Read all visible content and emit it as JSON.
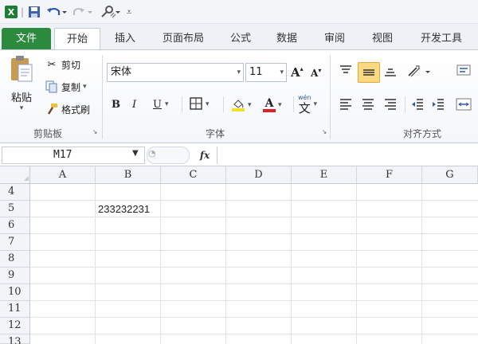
{
  "qat": {
    "excel_icon": "excel-logo-icon",
    "save_icon": "save-icon",
    "undo_icon": "undo-icon",
    "redo_icon": "redo-icon",
    "customize_icon": "customize-icon",
    "separator": "|"
  },
  "tabs": [
    "文件",
    "开始",
    "插入",
    "页面布局",
    "公式",
    "数据",
    "审阅",
    "视图",
    "开发工具"
  ],
  "clipboard": {
    "paste_label": "粘贴",
    "cut_label": "剪切",
    "copy_label": "复制",
    "format_painter_label": "格式刷",
    "group_label": "剪贴板"
  },
  "font": {
    "font_name": "宋体",
    "font_size": "11",
    "group_label": "字体",
    "bold": "B",
    "italic": "I",
    "underline": "U",
    "grow": "A",
    "shrink": "A",
    "font_color": "A",
    "wen": "wén",
    "phonetic": "文"
  },
  "alignment": {
    "group_label": "对齐方式"
  },
  "formula_bar": {
    "name_box": "M17",
    "fx_label": "fx",
    "value": ""
  },
  "grid": {
    "columns": [
      "A",
      "B",
      "C",
      "D",
      "E",
      "F",
      "G"
    ],
    "rows": [
      "4",
      "5",
      "6",
      "7",
      "8",
      "9",
      "10",
      "11",
      "12",
      "13"
    ],
    "cells": {
      "B5": "233232231"
    }
  },
  "colors": {
    "file_tab": "#2b8a3e",
    "accent_highlight": "#fbd983"
  }
}
